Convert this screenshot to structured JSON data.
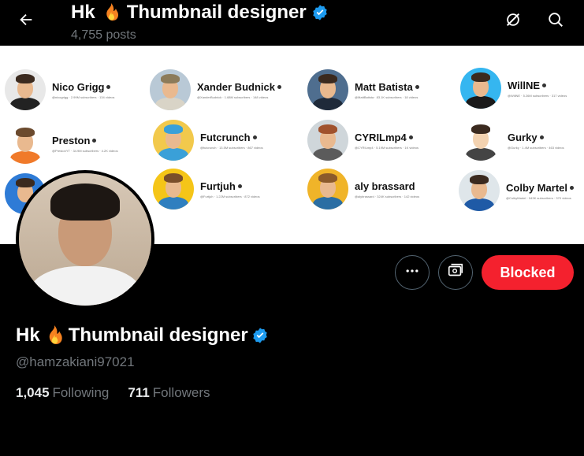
{
  "header": {
    "name_prefix": "Hk",
    "name_suffix": "Thumbnail designer",
    "posts": "4,755 posts"
  },
  "icons": {
    "back": "arrow-left-icon",
    "grok": "grok-icon",
    "search": "search-icon",
    "more": "more-horizontal-icon",
    "subscribe": "subscribe-icon",
    "fire": "fire-emoji",
    "verified": "verified-badge-icon"
  },
  "colors": {
    "verified": "#1d9bf0",
    "blocked": "#f4212e",
    "secondary_text": "#71767b"
  },
  "banner": {
    "creators": [
      {
        "name": "Nico Grigg",
        "sub": "@nicogrigg · 2.99M subscribers · 134 videos",
        "bg": "#e8e8e8",
        "shirt": "#222"
      },
      {
        "name": "Xander Budnick",
        "sub": "@XanderBudnick · 1.68M subscribers · 148 videos",
        "bg": "#b9c9d6",
        "shirt": "#d9d4c7"
      },
      {
        "name": "Matt Batista",
        "sub": "@MattBatista · 83.1K subscribers · 18 videos",
        "bg": "#4f6e8f",
        "shirt": "#1f2a3a"
      },
      {
        "name": "WillNE",
        "sub": "@WillNE · 5.26M subscribers · 317 videos",
        "bg": "#35b6f0",
        "shirt": "#1a1a1a"
      },
      {
        "name": "Preston",
        "sub": "@PrestonYT · 34.9M subscribers · 4.2K videos",
        "bg": "#ffffff",
        "shirt": "#f07a2a"
      },
      {
        "name": "Futcrunch",
        "sub": "@futcrunch · 13.5M subscribers · 867 videos",
        "bg": "#f2c94c",
        "shirt": "#3aa0d8"
      },
      {
        "name": "CYRILmp4",
        "sub": "@CYRILmp4 · 5.19M subscribers · 1K videos",
        "bg": "#cfd6da",
        "shirt": "#5b5b5b"
      },
      {
        "name": "Gurky",
        "sub": "@Gurky · 1.4M subscribers · 463 videos",
        "bg": "#ffffff",
        "shirt": "#444"
      },
      {
        "name": "",
        "sub": "",
        "bg": "#2e7bd6",
        "shirt": "#2e7bd6"
      },
      {
        "name": "Furtjuh",
        "sub": "@Furtjuh · 1.22M subscribers · 872 videos",
        "bg": "#f5c518",
        "shirt": "#2f7fbf"
      },
      {
        "name": "aly brassard",
        "sub": "@alybrassard · 324K subscribers · 142 videos",
        "bg": "#f0b429",
        "shirt": "#2b6ea3"
      },
      {
        "name": "Colby Martel",
        "sub": "@ColbyMartel · 543K subscribers · 370 videos",
        "bg": "#dfe6ea",
        "shirt": "#1f5aa6"
      }
    ]
  },
  "actions": {
    "blocked_label": "Blocked"
  },
  "profile": {
    "name_prefix": "Hk",
    "name_suffix": "Thumbnail designer",
    "handle": "@hamzakiani97021",
    "following_count": "1,045",
    "following_label": "Following",
    "followers_count": "711",
    "followers_label": "Followers"
  }
}
